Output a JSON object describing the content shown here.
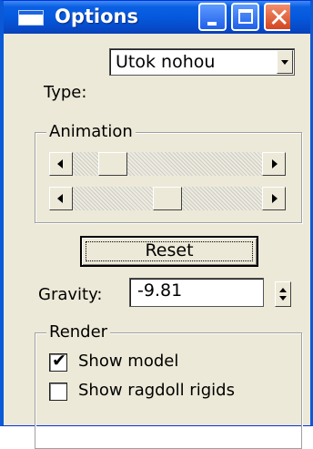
{
  "window": {
    "title": "Options",
    "icons": {
      "app": "window-icon",
      "minimize": "minimize-icon",
      "maximize": "maximize-icon",
      "close": "close-icon"
    },
    "close_glyph": "✕"
  },
  "type_row": {
    "label": "Type:",
    "selected": "Utok nohou"
  },
  "animation": {
    "title": "Animation",
    "sliders": [
      {
        "name": "animation-slider-1",
        "value_fraction": 0.16
      },
      {
        "name": "animation-slider-2",
        "value_fraction": 0.5
      }
    ]
  },
  "reset_label": "Reset",
  "gravity": {
    "label": "Gravity:",
    "value": "-9.81"
  },
  "render": {
    "title": "Render",
    "show_model": {
      "label": "Show model",
      "checked": true,
      "mark": "✔"
    },
    "show_ragdoll": {
      "label": "Show ragdoll rigids",
      "checked": false
    }
  },
  "colors": {
    "titlebar": "#0559dc",
    "client_bg": "#ece9d8",
    "close_button": "#d2461f"
  }
}
